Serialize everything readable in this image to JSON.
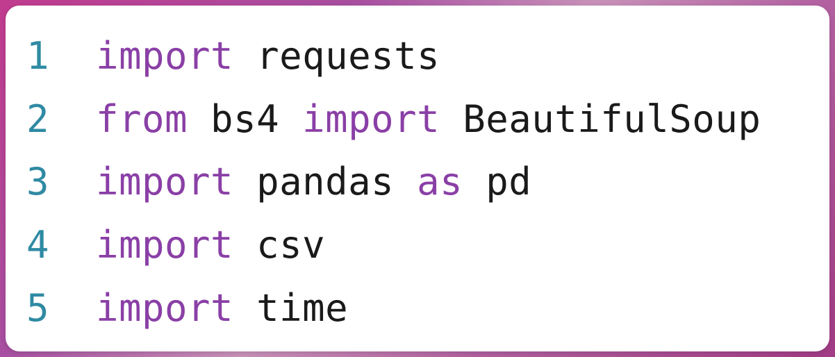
{
  "code": {
    "lines": [
      {
        "num": "1",
        "tokens": [
          {
            "t": "import",
            "c": "kw"
          },
          {
            "t": " requests",
            "c": "plain"
          }
        ]
      },
      {
        "num": "2",
        "tokens": [
          {
            "t": "from",
            "c": "kw"
          },
          {
            "t": " bs4 ",
            "c": "plain"
          },
          {
            "t": "import",
            "c": "kw"
          },
          {
            "t": " BeautifulSoup",
            "c": "plain"
          }
        ]
      },
      {
        "num": "3",
        "tokens": [
          {
            "t": "import",
            "c": "kw"
          },
          {
            "t": " pandas ",
            "c": "plain"
          },
          {
            "t": "as",
            "c": "kw"
          },
          {
            "t": " pd",
            "c": "plain"
          }
        ]
      },
      {
        "num": "4",
        "tokens": [
          {
            "t": "import",
            "c": "kw"
          },
          {
            "t": " csv",
            "c": "plain"
          }
        ]
      },
      {
        "num": "5",
        "tokens": [
          {
            "t": "import",
            "c": "kw"
          },
          {
            "t": " time",
            "c": "plain"
          }
        ]
      }
    ]
  }
}
